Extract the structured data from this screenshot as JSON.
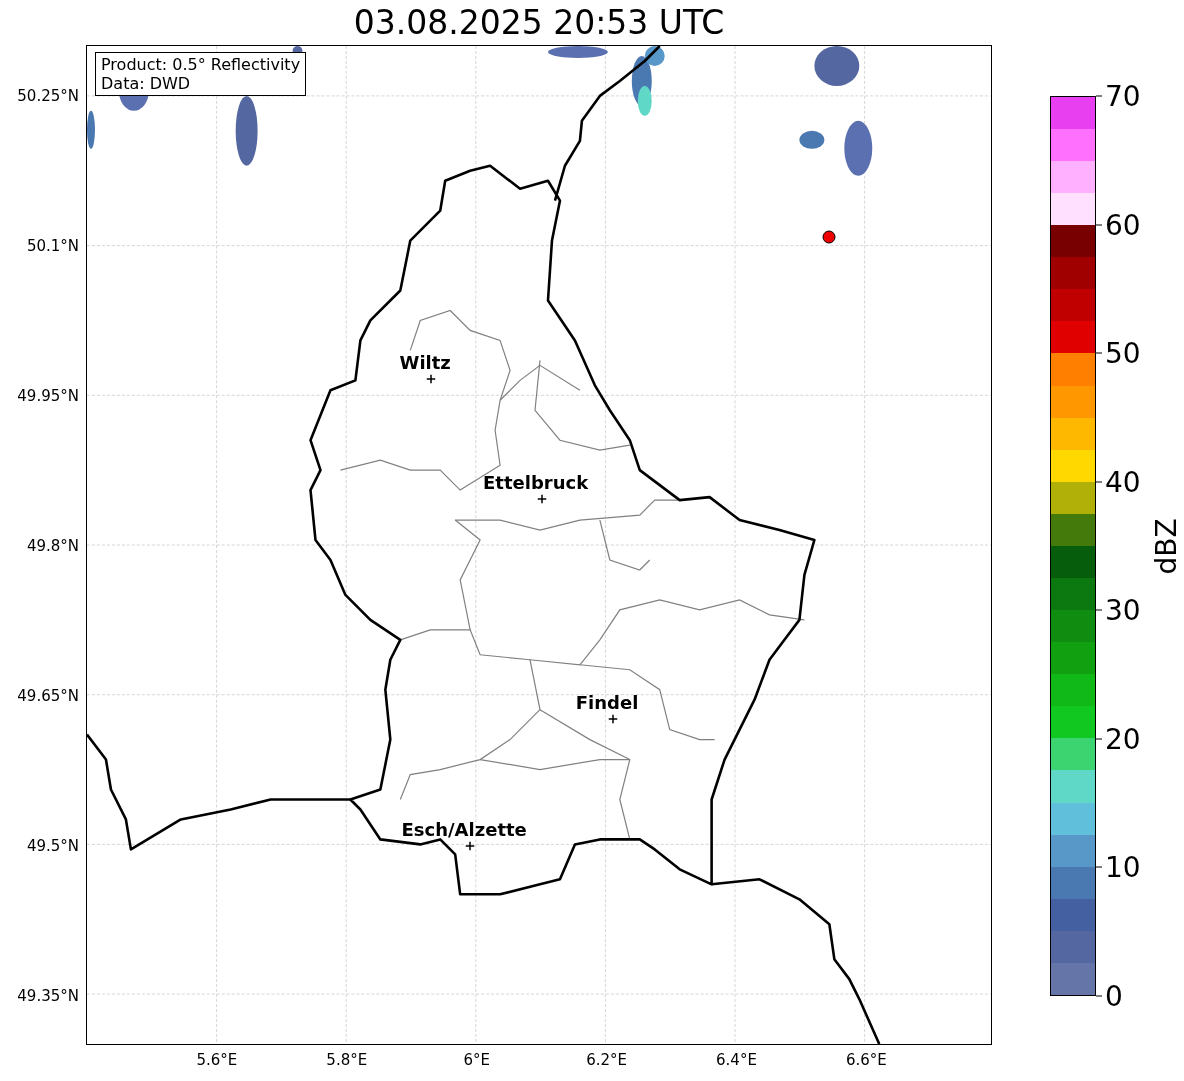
{
  "title": "03.08.2025 20:53 UTC",
  "info_box": [
    "Product: 0.5° Reflectivity",
    "Data: DWD"
  ],
  "map": {
    "xticks": [
      "5.6°E",
      "5.8°E",
      "6°E",
      "6.2°E",
      "6.4°E",
      "6.6°E"
    ],
    "yticks": [
      "50.25°N",
      "50.1°N",
      "49.95°N",
      "49.8°N",
      "49.65°N",
      "49.5°N",
      "49.35°N"
    ],
    "cities": [
      "Wiltz",
      "Ettelbruck",
      "Findel",
      "Esch/Alzette"
    ]
  },
  "colorbar": {
    "label": "dBZ",
    "ticks": [
      "70",
      "60",
      "50",
      "40",
      "30",
      "20",
      "10",
      "0"
    ]
  }
}
